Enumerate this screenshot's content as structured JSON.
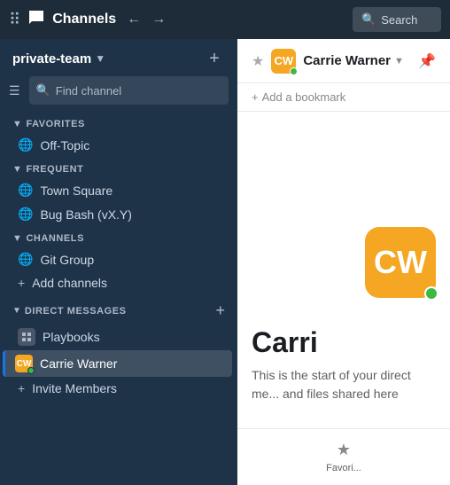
{
  "topbar": {
    "title": "Channels",
    "search_placeholder": "Search"
  },
  "sidebar": {
    "workspace": "private-team",
    "search_placeholder": "Find channel",
    "sections": {
      "favorites": {
        "label": "FAVORITES",
        "items": [
          {
            "icon": "globe",
            "label": "Off-Topic"
          }
        ]
      },
      "frequent": {
        "label": "FREQUENT",
        "items": [
          {
            "icon": "globe",
            "label": "Town Square"
          },
          {
            "icon": "globe",
            "label": "Bug Bash (vX.Y)"
          }
        ]
      },
      "channels": {
        "label": "CHANNELS",
        "items": [
          {
            "icon": "globe",
            "label": "Git Group"
          },
          {
            "icon": "plus",
            "label": "Add channels"
          }
        ]
      },
      "direct_messages": {
        "label": "DIRECT MESSAGES",
        "items": [
          {
            "icon": "grid",
            "label": "Playbooks",
            "avatar": false
          },
          {
            "icon": "avatar",
            "label": "Carrie Warner",
            "avatar": true,
            "active": true
          }
        ]
      },
      "invite": {
        "label": "Invite Members"
      }
    }
  },
  "chat": {
    "user_name": "Carrie Warner",
    "bookmark_label": "Add a bookmark",
    "intro_name": "Carri",
    "intro_text": "This is the start of your direct me... and files shared here",
    "bottom_actions": [
      {
        "icon": "★",
        "label": "Favori..."
      }
    ]
  }
}
